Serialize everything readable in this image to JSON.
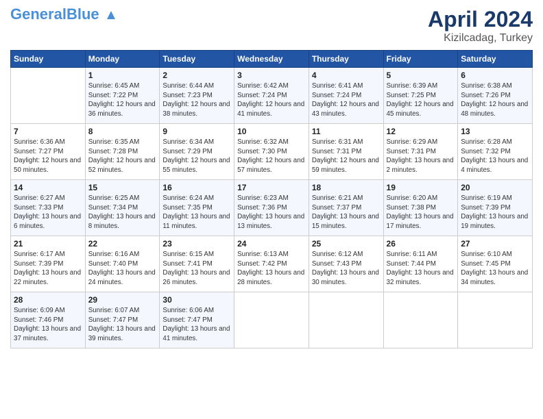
{
  "header": {
    "logo_general": "General",
    "logo_blue": "Blue",
    "month": "April 2024",
    "location": "Kizilcadag, Turkey"
  },
  "columns": [
    "Sunday",
    "Monday",
    "Tuesday",
    "Wednesday",
    "Thursday",
    "Friday",
    "Saturday"
  ],
  "weeks": [
    [
      {
        "day": "",
        "sunrise": "",
        "sunset": "",
        "daylight": ""
      },
      {
        "day": "1",
        "sunrise": "Sunrise: 6:45 AM",
        "sunset": "Sunset: 7:22 PM",
        "daylight": "Daylight: 12 hours and 36 minutes."
      },
      {
        "day": "2",
        "sunrise": "Sunrise: 6:44 AM",
        "sunset": "Sunset: 7:23 PM",
        "daylight": "Daylight: 12 hours and 38 minutes."
      },
      {
        "day": "3",
        "sunrise": "Sunrise: 6:42 AM",
        "sunset": "Sunset: 7:24 PM",
        "daylight": "Daylight: 12 hours and 41 minutes."
      },
      {
        "day": "4",
        "sunrise": "Sunrise: 6:41 AM",
        "sunset": "Sunset: 7:24 PM",
        "daylight": "Daylight: 12 hours and 43 minutes."
      },
      {
        "day": "5",
        "sunrise": "Sunrise: 6:39 AM",
        "sunset": "Sunset: 7:25 PM",
        "daylight": "Daylight: 12 hours and 45 minutes."
      },
      {
        "day": "6",
        "sunrise": "Sunrise: 6:38 AM",
        "sunset": "Sunset: 7:26 PM",
        "daylight": "Daylight: 12 hours and 48 minutes."
      }
    ],
    [
      {
        "day": "7",
        "sunrise": "Sunrise: 6:36 AM",
        "sunset": "Sunset: 7:27 PM",
        "daylight": "Daylight: 12 hours and 50 minutes."
      },
      {
        "day": "8",
        "sunrise": "Sunrise: 6:35 AM",
        "sunset": "Sunset: 7:28 PM",
        "daylight": "Daylight: 12 hours and 52 minutes."
      },
      {
        "day": "9",
        "sunrise": "Sunrise: 6:34 AM",
        "sunset": "Sunset: 7:29 PM",
        "daylight": "Daylight: 12 hours and 55 minutes."
      },
      {
        "day": "10",
        "sunrise": "Sunrise: 6:32 AM",
        "sunset": "Sunset: 7:30 PM",
        "daylight": "Daylight: 12 hours and 57 minutes."
      },
      {
        "day": "11",
        "sunrise": "Sunrise: 6:31 AM",
        "sunset": "Sunset: 7:31 PM",
        "daylight": "Daylight: 12 hours and 59 minutes."
      },
      {
        "day": "12",
        "sunrise": "Sunrise: 6:29 AM",
        "sunset": "Sunset: 7:31 PM",
        "daylight": "Daylight: 13 hours and 2 minutes."
      },
      {
        "day": "13",
        "sunrise": "Sunrise: 6:28 AM",
        "sunset": "Sunset: 7:32 PM",
        "daylight": "Daylight: 13 hours and 4 minutes."
      }
    ],
    [
      {
        "day": "14",
        "sunrise": "Sunrise: 6:27 AM",
        "sunset": "Sunset: 7:33 PM",
        "daylight": "Daylight: 13 hours and 6 minutes."
      },
      {
        "day": "15",
        "sunrise": "Sunrise: 6:25 AM",
        "sunset": "Sunset: 7:34 PM",
        "daylight": "Daylight: 13 hours and 8 minutes."
      },
      {
        "day": "16",
        "sunrise": "Sunrise: 6:24 AM",
        "sunset": "Sunset: 7:35 PM",
        "daylight": "Daylight: 13 hours and 11 minutes."
      },
      {
        "day": "17",
        "sunrise": "Sunrise: 6:23 AM",
        "sunset": "Sunset: 7:36 PM",
        "daylight": "Daylight: 13 hours and 13 minutes."
      },
      {
        "day": "18",
        "sunrise": "Sunrise: 6:21 AM",
        "sunset": "Sunset: 7:37 PM",
        "daylight": "Daylight: 13 hours and 15 minutes."
      },
      {
        "day": "19",
        "sunrise": "Sunrise: 6:20 AM",
        "sunset": "Sunset: 7:38 PM",
        "daylight": "Daylight: 13 hours and 17 minutes."
      },
      {
        "day": "20",
        "sunrise": "Sunrise: 6:19 AM",
        "sunset": "Sunset: 7:39 PM",
        "daylight": "Daylight: 13 hours and 19 minutes."
      }
    ],
    [
      {
        "day": "21",
        "sunrise": "Sunrise: 6:17 AM",
        "sunset": "Sunset: 7:39 PM",
        "daylight": "Daylight: 13 hours and 22 minutes."
      },
      {
        "day": "22",
        "sunrise": "Sunrise: 6:16 AM",
        "sunset": "Sunset: 7:40 PM",
        "daylight": "Daylight: 13 hours and 24 minutes."
      },
      {
        "day": "23",
        "sunrise": "Sunrise: 6:15 AM",
        "sunset": "Sunset: 7:41 PM",
        "daylight": "Daylight: 13 hours and 26 minutes."
      },
      {
        "day": "24",
        "sunrise": "Sunrise: 6:13 AM",
        "sunset": "Sunset: 7:42 PM",
        "daylight": "Daylight: 13 hours and 28 minutes."
      },
      {
        "day": "25",
        "sunrise": "Sunrise: 6:12 AM",
        "sunset": "Sunset: 7:43 PM",
        "daylight": "Daylight: 13 hours and 30 minutes."
      },
      {
        "day": "26",
        "sunrise": "Sunrise: 6:11 AM",
        "sunset": "Sunset: 7:44 PM",
        "daylight": "Daylight: 13 hours and 32 minutes."
      },
      {
        "day": "27",
        "sunrise": "Sunrise: 6:10 AM",
        "sunset": "Sunset: 7:45 PM",
        "daylight": "Daylight: 13 hours and 34 minutes."
      }
    ],
    [
      {
        "day": "28",
        "sunrise": "Sunrise: 6:09 AM",
        "sunset": "Sunset: 7:46 PM",
        "daylight": "Daylight: 13 hours and 37 minutes."
      },
      {
        "day": "29",
        "sunrise": "Sunrise: 6:07 AM",
        "sunset": "Sunset: 7:47 PM",
        "daylight": "Daylight: 13 hours and 39 minutes."
      },
      {
        "day": "30",
        "sunrise": "Sunrise: 6:06 AM",
        "sunset": "Sunset: 7:47 PM",
        "daylight": "Daylight: 13 hours and 41 minutes."
      },
      {
        "day": "",
        "sunrise": "",
        "sunset": "",
        "daylight": ""
      },
      {
        "day": "",
        "sunrise": "",
        "sunset": "",
        "daylight": ""
      },
      {
        "day": "",
        "sunrise": "",
        "sunset": "",
        "daylight": ""
      },
      {
        "day": "",
        "sunrise": "",
        "sunset": "",
        "daylight": ""
      }
    ]
  ]
}
